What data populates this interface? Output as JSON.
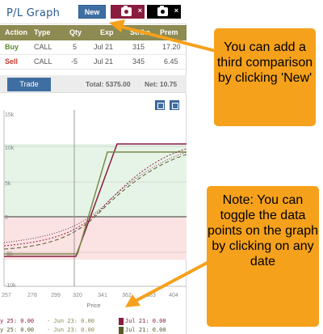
{
  "header": {
    "title": "P/L Graph",
    "new_label": "New",
    "close_glyph": "×"
  },
  "table": {
    "columns": [
      "Action",
      "Type",
      "Qty",
      "Exp",
      "Strike",
      "Prem"
    ],
    "rows": [
      {
        "action": "Buy",
        "type": "CALL",
        "qty": "5",
        "exp": "Jul 21",
        "strike": "315",
        "prem": "17.20"
      },
      {
        "action": "Sell",
        "type": "CALL",
        "qty": "-5",
        "exp": "Jul 21",
        "strike": "345",
        "prem": "6.45"
      }
    ]
  },
  "tradebar": {
    "trade_label": "Trade",
    "total": "Total: 5375.00",
    "net": "Net: 10.75"
  },
  "chart": {
    "y_ticks": [
      "15k",
      "10k",
      "5k",
      "0",
      "-5k",
      "-10k"
    ],
    "x_ticks": [
      "257",
      "278",
      "299",
      "320",
      "341",
      "362",
      "383",
      "404"
    ],
    "x_label": "Price"
  },
  "legend": {
    "entries": [
      {
        "text": "y 25: 0.00",
        "color": "#8a1d3f"
      },
      {
        "text": "- Jun 23: 0.00",
        "color": "#8d8a52"
      },
      {
        "text": "Jul 21: 0.00",
        "color": "#8a1d3f"
      },
      {
        "text": "y 25: 0.00",
        "color": "#5a5a2a"
      },
      {
        "text": "- Jun 23: 0.00",
        "color": "#8d8a52"
      },
      {
        "text": "Jul 21: 0.00",
        "color": "#5a5a2a"
      }
    ]
  },
  "callouts": {
    "new_tip": "You can add a third comparison by clicking 'New'",
    "toggle_tip": "Note: You can toggle the data points on the graph by clicking on any date"
  },
  "colors": {
    "accent_blue": "#3f6ea3",
    "olive": "#8d8a52",
    "maroon": "#8a1d3f",
    "buy_green": "#5a8a2a",
    "sell_red": "#c0392b",
    "callout_orange": "#f5a11c"
  },
  "icons": [
    "camera-icon",
    "close-icon",
    "chart-tool-icon",
    "expand-icon"
  ]
}
